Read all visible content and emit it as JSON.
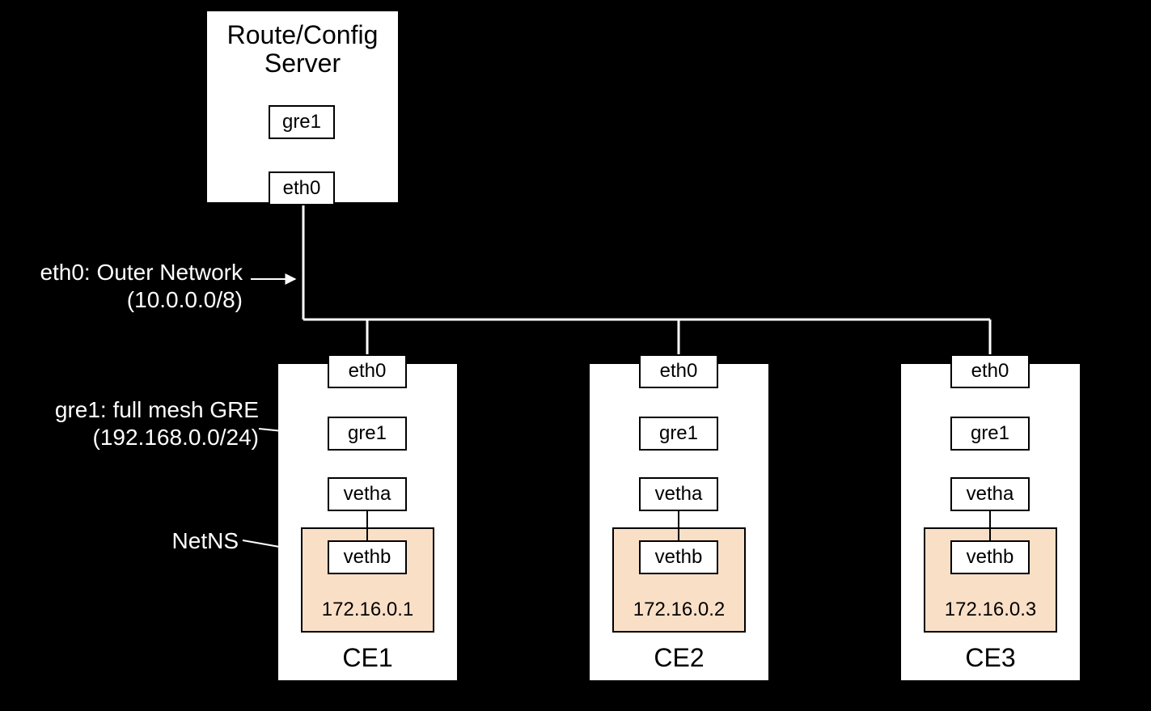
{
  "route_server": {
    "title_line1": "Route/Config",
    "title_line2": "Server",
    "gre1": "gre1",
    "eth0": "eth0"
  },
  "outer_network_label": "eth0: Outer Network\n(10.0.0.0/8)",
  "gre_mesh_label": "gre1: full mesh GRE\n(192.168.0.0/24)",
  "netns_label": "NetNS",
  "ce_nodes": [
    {
      "name": "CE1",
      "eth0": "eth0",
      "gre1": "gre1",
      "vetha": "vetha",
      "vethb": "vethb",
      "ip": "172.16.0.1"
    },
    {
      "name": "CE2",
      "eth0": "eth0",
      "gre1": "gre1",
      "vetha": "vetha",
      "vethb": "vethb",
      "ip": "172.16.0.2"
    },
    {
      "name": "CE3",
      "eth0": "eth0",
      "gre1": "gre1",
      "vetha": "vetha",
      "vethb": "vethb",
      "ip": "172.16.0.3"
    }
  ]
}
